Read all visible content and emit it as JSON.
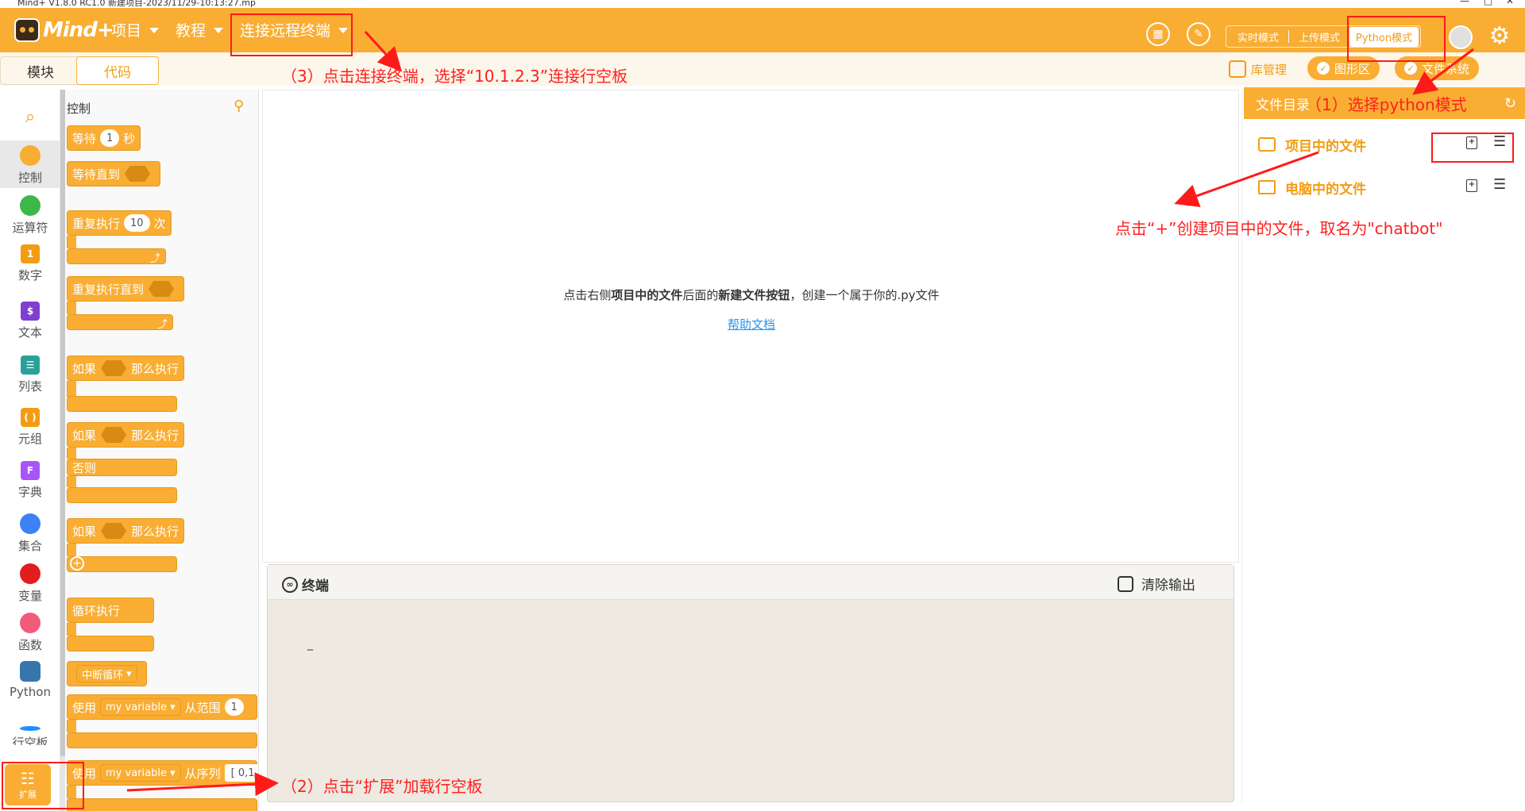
{
  "window": {
    "title": "Mind+ V1.8.0 RC1.0   新建项目-2023/11/29-10:13:27.mp",
    "controls": [
      "—",
      "□",
      "✕"
    ]
  },
  "header": {
    "logo": "Mind+",
    "menu": [
      {
        "label": "项目"
      },
      {
        "label": "教程"
      },
      {
        "label": "连接远程终端"
      }
    ],
    "modes": {
      "realtime": "实时模式",
      "upload": "上传模式",
      "python": "Python模式"
    }
  },
  "subbar": {
    "tabs": {
      "blocks": "模块",
      "code": "代码"
    },
    "library": "库管理",
    "graphic": "图形区",
    "filesystem": "文件系统"
  },
  "categories": [
    {
      "label": "控制",
      "color": "#f9ad33"
    },
    {
      "label": "运算符",
      "color": "#3cb84a"
    },
    {
      "label": "数字",
      "color": "#f39c12"
    },
    {
      "label": "文本",
      "color": "#7f3fd1"
    },
    {
      "label": "列表",
      "color": "#2aa198"
    },
    {
      "label": "元组",
      "color": "#f39c12"
    },
    {
      "label": "字典",
      "color": "#a855f7"
    },
    {
      "label": "集合",
      "color": "#3b82f6"
    },
    {
      "label": "变量",
      "color": "#e11d1d"
    },
    {
      "label": "函数",
      "color": "#f25c7a"
    },
    {
      "label": "Python",
      "color": "#3776ab"
    },
    {
      "label": "行空板",
      "color": "#1e90ff"
    }
  ],
  "extension": {
    "label": "扩展"
  },
  "palette": {
    "title": "控制",
    "blocks": {
      "wait": "等待",
      "wait_num": "1",
      "wait_unit": "秒",
      "wait_until": "等待直到",
      "repeat": "重复执行",
      "repeat_num": "10",
      "repeat_unit": "次",
      "repeat_until": "重复执行直到",
      "if1": "如果",
      "then1": "那么执行",
      "if2": "如果",
      "then2": "那么执行",
      "else": "否则",
      "if3": "如果",
      "then3": "那么执行",
      "loop": "循环执行",
      "break": "中断循环",
      "for_use": "使用",
      "for_var": "my variable",
      "for_range": "从范围",
      "for_num": "1",
      "for2_use": "使用",
      "for2_var": "my variable",
      "for2_seq": "从序列",
      "for2_val": "[ 0,1"
    }
  },
  "editor": {
    "hint_pre": "点击右侧",
    "hint_b1": "项目中的文件",
    "hint_mid": "后面的",
    "hint_b2": "新建文件按钮",
    "hint_post": "，创建一个属于你的.py文件",
    "help_link": "帮助文档"
  },
  "terminal": {
    "title": "终端",
    "clear": "清除输出",
    "cursor": "_"
  },
  "filepanel": {
    "title": "文件目录",
    "project_files": "项目中的文件",
    "computer_files": "电脑中的文件"
  },
  "annotations": {
    "a1": "（1）选择python模式",
    "a2": "（2）点击“扩展”加载行空板",
    "a3": "（3）点击连接终端，选择“10.1.2.3”连接行空板",
    "a4": "点击“+”创建项目中的文件，取名为\"chatbot\""
  },
  "colors": {
    "accent": "#f9ad33",
    "annotation": "#ff1a1a",
    "link": "#2196f3"
  }
}
